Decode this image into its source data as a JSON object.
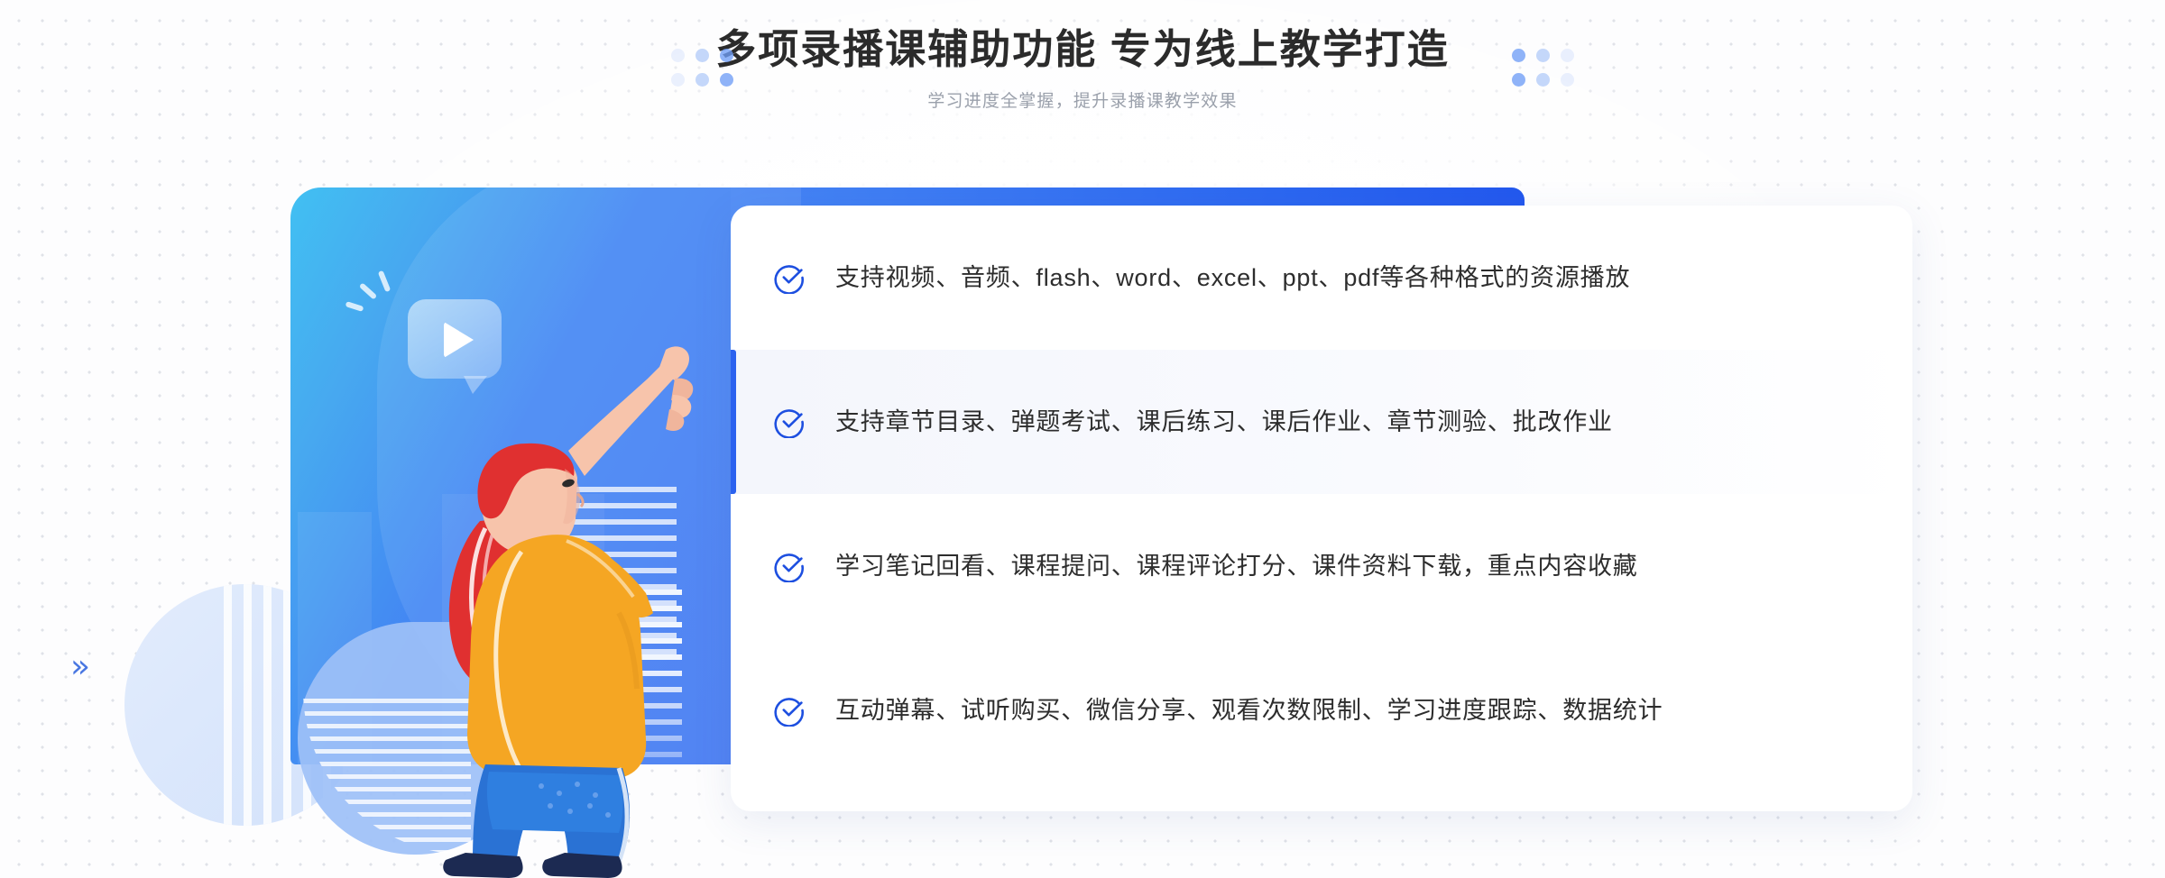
{
  "header": {
    "title": "多项录播课辅助功能 专为线上教学打造",
    "subtitle": "学习进度全掌握，提升录播课教学效果"
  },
  "illustration": {
    "alt_name": "woman-pointing-at-video-play-bubble",
    "play_icon": "play-icon",
    "bubble_icon": "speech-bubble-icon"
  },
  "features": [
    {
      "icon": "circle-check-icon",
      "text": "支持视频、音频、flash、word、excel、ppt、pdf等各种格式的资源播放",
      "active": false
    },
    {
      "icon": "circle-check-icon",
      "text": "支持章节目录、弹题考试、课后练习、课后作业、章节测验、批改作业",
      "active": true
    },
    {
      "icon": "circle-check-icon",
      "text": "学习笔记回看、课程提问、课程评论打分、课件资料下载，重点内容收藏",
      "active": false
    },
    {
      "icon": "circle-check-icon",
      "text": "互动弹幕、试听购买、微信分享、观看次数限制、学习进度跟踪、数据统计",
      "active": false
    }
  ],
  "decorations": {
    "chevron_right": "»",
    "chevron_left": "«",
    "dot_cluster_left": "dot-cluster-left",
    "dot_cluster_right": "dot-cluster-right"
  },
  "colors": {
    "accent_blue": "#2b62ef",
    "check_blue": "#1d4fe0",
    "title_text": "#2b2b2b",
    "subtitle_text": "#9aa0ab",
    "card_bg": "#ffffff",
    "active_row_bg": "#f6f8fd",
    "illustration_from": "#41c0f2",
    "illustration_to": "#4177f2"
  }
}
